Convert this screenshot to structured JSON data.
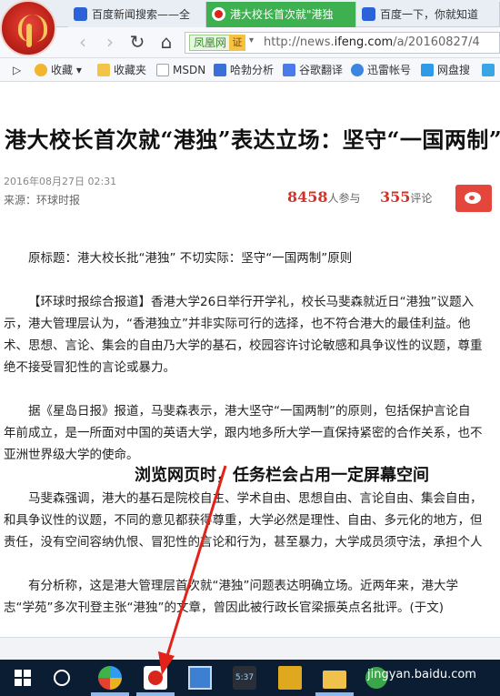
{
  "tabs": [
    {
      "title": "百度新闻搜索——全",
      "close": "×"
    },
    {
      "title": "港大校长首次就\"港独",
      "close": "×"
    },
    {
      "title": "百度一下，你就知道",
      "close": "×"
    }
  ],
  "nav": {
    "back_glyph": "‹",
    "forward_glyph": "›",
    "reload_glyph": "↻",
    "home_glyph": "⌂",
    "site_tag": "凤凰网",
    "cert_label": "证",
    "dropdown_glyph": "▾",
    "url_prefix": "http://news.",
    "url_domain": "ifeng.com",
    "url_path": "/a/20160827/4"
  },
  "bookmarks": [
    {
      "label": "▷",
      "icon_color": ""
    },
    {
      "label": "收藏 ▾",
      "icon_color": "#f2b530"
    },
    {
      "label": "收藏夹",
      "icon_color": "#f2c548"
    },
    {
      "label": "MSDN",
      "icon_color": "#c9ced6"
    },
    {
      "label": "哈勃分析",
      "icon_color": "#3a6fd8"
    },
    {
      "label": "谷歌翻译",
      "icon_color": "#4a7be8"
    },
    {
      "label": "迅雷帐号",
      "icon_color": "#3a86e0"
    },
    {
      "label": "网盘搜",
      "icon_color": "#2f9be8"
    },
    {
      "label": "",
      "icon_color": "#3aa5e5"
    }
  ],
  "article": {
    "headline": "港大校长首次就“港独”表达立场：坚守“一国两制”",
    "date": "2016年08月27日  02:31",
    "source": "来源：环球时报",
    "participants_count": "8458",
    "participants_label": "人参与",
    "comments_count": "355",
    "comments_label": "评论",
    "paragraphs": [
      [
        "原标题：港大校长批“港独” 不切实际：坚守“一国两制”原则"
      ],
      [
        "【环球时报综合报道】香港大学26日举行开学礼，校长马斐森就近日“港独”议题入",
        "示，港大管理层认为，“香港独立”并非实际可行的选择，也不符合港大的最佳利益。他",
        "术、思想、言论、集会的自由乃大学的基石，校园容许讨论敏感和具争议性的议题，尊重",
        "绝不接受冒犯性的言论或暴力。"
      ],
      [
        "据《星岛日报》报道，马斐森表示，港大坚守“一国两制”的原则，包括保护言论自",
        "年前成立，是一所面对中国的英语大学，跟内地多所大学一直保持紧密的合作关系，也不",
        "亚洲世界级大学的使命。"
      ],
      [
        "马斐森强调，港大的基石是院校自主、学术自由、思想自由、言论自由、集会自由，",
        "和具争议性的议题，不同的意见都获得尊重，大学必然是理性、自由、多元化的地方，但",
        "责任，没有空间容纳仇恨、冒犯性的言论和行为，甚至暴力，大学成员须守法，承担个人"
      ],
      [
        "有分析称，这是港大管理层首次就“港独”问题表达明确立场。近两年来，港大学",
        "志“学苑”多次刊登主张“港独”的文章，曾因此被行政长官梁振英点名批评。(于文)"
      ]
    ]
  },
  "annotation": "浏览网页时，任务栏会占用一定屏幕空间",
  "taskbar": {
    "clock_label": "5:37",
    "watermark": "jingyan.baidu.com"
  }
}
